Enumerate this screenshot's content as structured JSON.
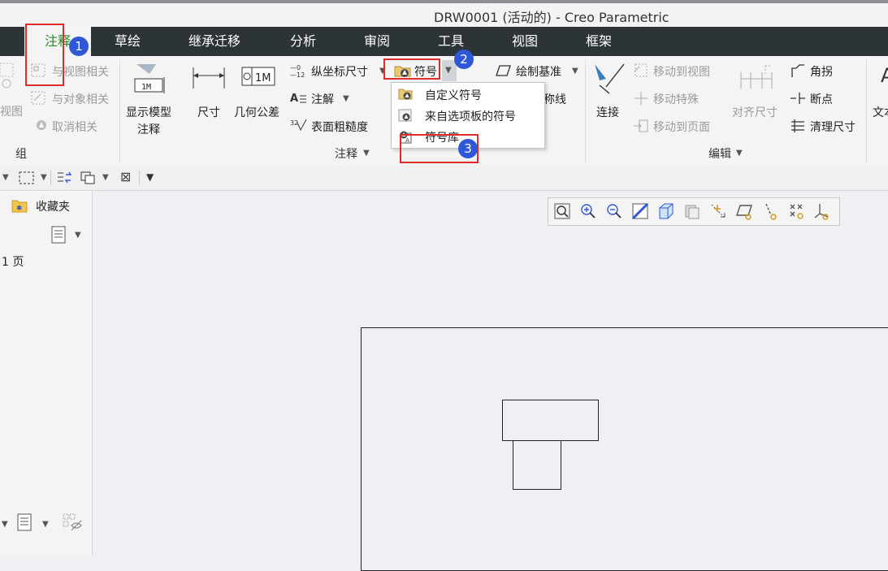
{
  "window": {
    "title": "DRW0001 (活动的) - Creo Parametric"
  },
  "tabs": [
    {
      "label": "注释",
      "active": true
    },
    {
      "label": "草绘"
    },
    {
      "label": "继承迁移"
    },
    {
      "label": "分析"
    },
    {
      "label": "审阅"
    },
    {
      "label": "工具"
    },
    {
      "label": "视图"
    },
    {
      "label": "框架"
    }
  ],
  "ribbon": {
    "group_left": {
      "view_label": "视图",
      "relate_view": "与视图相关",
      "relate_object": "与对象相关",
      "unrelate": "取消相关",
      "group_label": "组"
    },
    "annotation": {
      "show_model_annotation": [
        "显示模型",
        "注释"
      ],
      "dimension": "尺寸",
      "geometric_tolerance": "几何公差",
      "ordinate_dimension": "纵坐标尺寸",
      "note": "注解",
      "surface_roughness": "表面粗糙度",
      "symbol": "符号",
      "draw_datum": "绘制基准",
      "centerline_fragment": "称线",
      "group_label": "注释"
    },
    "edit": {
      "connect": "连接",
      "move_to_view": "移动到视图",
      "move_special": "移动特殊",
      "move_to_page": "移动到页面",
      "align_dimension": "对齐尺寸",
      "jog": "角拐",
      "break_point": "断点",
      "cleanup_dimension": "清理尺寸",
      "group_label": "编辑"
    },
    "text_fragment": "文本"
  },
  "symbol_dropdown": {
    "items": [
      "自定义符号",
      "来自选项板的符号",
      "符号库"
    ]
  },
  "left_panel": {
    "favorites": "收藏夹",
    "page_label": "1 页"
  },
  "badges": [
    "1",
    "2",
    "3"
  ],
  "colors": {
    "tab_bar": "#2d3437",
    "active_tab_text": "#2a8a2a",
    "highlight_box": "#e02b2b",
    "badge": "#2f58d6"
  }
}
